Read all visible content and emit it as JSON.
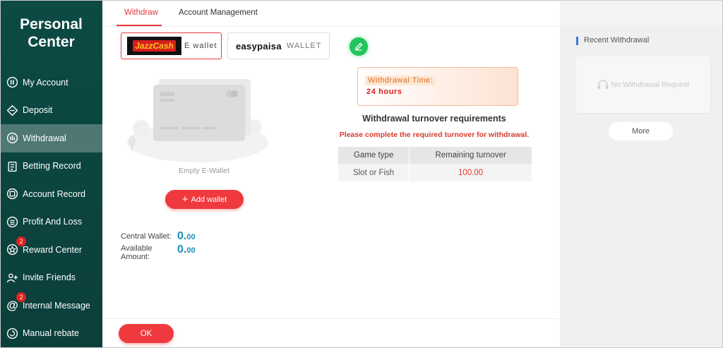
{
  "sidebar": {
    "title_line1": "Personal",
    "title_line2": "Center",
    "items": [
      {
        "label": "My Account",
        "icon": "account-icon",
        "active": false
      },
      {
        "label": "Deposit",
        "icon": "deposit-icon",
        "active": false
      },
      {
        "label": "Withdrawal",
        "icon": "withdrawal-icon",
        "active": true
      },
      {
        "label": "Betting Record",
        "icon": "betting-record-icon",
        "active": false
      },
      {
        "label": "Account Record",
        "icon": "account-record-icon",
        "active": false
      },
      {
        "label": "Profit And Loss",
        "icon": "profit-loss-icon",
        "active": false
      },
      {
        "label": "Reward Center",
        "icon": "reward-icon",
        "active": false,
        "badge": "2"
      },
      {
        "label": "Invite Friends",
        "icon": "invite-icon",
        "active": false
      },
      {
        "label": "Internal Message",
        "icon": "at-icon",
        "active": false,
        "badge": "2"
      },
      {
        "label": "Manual rebate",
        "icon": "rebate-icon",
        "active": false
      }
    ]
  },
  "tabs": {
    "withdraw": "Withdraw",
    "account_management": "Account Management"
  },
  "wallets": {
    "jazzcash_logo": "JazzCash",
    "jazzcash_label": "E wallet",
    "easypaisa_logo": "easypaisa",
    "easypaisa_label": "WALLET"
  },
  "empty_wallet": {
    "label": "Empty E-Wallet",
    "add_button": "Add wallet"
  },
  "balances": {
    "central_label": "Central Wallet:",
    "central_int": "0.",
    "central_dec": "00",
    "available_label_1": "Available",
    "available_label_2": "Amount:",
    "available_int": "0.",
    "available_dec": "00"
  },
  "withdrawal_time": {
    "label": "Withdrawal Time:",
    "value": "24 hours"
  },
  "turnover": {
    "title": "Withdrawal turnover requirements",
    "note": "Please complete the required turnover for withdrawal.",
    "headers": [
      "Game type",
      "Remaining turnover"
    ],
    "rows": [
      [
        "Slot or Fish",
        "100.00"
      ]
    ]
  },
  "ok_button": "OK",
  "recent": {
    "title": "Recent Withdrawal",
    "empty": "No Withdrawal Request",
    "more": "More"
  },
  "colors": {
    "sidebar_bg": "#0d4a44",
    "accent_red": "#ee3a3e",
    "balance_blue": "#1a8fb8",
    "success_green": "#22c55e"
  }
}
